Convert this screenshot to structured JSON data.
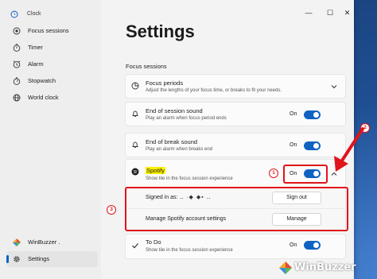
{
  "window": {
    "app_title": "Clock",
    "controls": [
      "—",
      "☐",
      "✕"
    ]
  },
  "sidebar": {
    "items": [
      {
        "label": "Focus sessions",
        "icon": "focus-icon"
      },
      {
        "label": "Timer",
        "icon": "timer-icon"
      },
      {
        "label": "Alarm",
        "icon": "alarm-icon"
      },
      {
        "label": "Stopwatch",
        "icon": "stopwatch-icon"
      },
      {
        "label": "World clock",
        "icon": "globe-icon"
      }
    ],
    "account_label": "WinBuzzer .",
    "settings_label": "Settings"
  },
  "main": {
    "title": "Settings",
    "section": "Focus sessions",
    "focus_periods": {
      "title": "Focus periods",
      "desc": "Adjust the lengths of your focus time, or breaks to fit your needs."
    },
    "end_session_sound": {
      "title": "End of session sound",
      "desc": "Play an alarm when focus period ends",
      "toggle": "On"
    },
    "end_break_sound": {
      "title": "End of break sound",
      "desc": "Play an alarm when breaks end",
      "toggle": "On"
    },
    "spotify": {
      "title": "Spotify",
      "desc": "Show tile in the focus session experience",
      "toggle": "On",
      "signed_in_label": "Signed in as:",
      "signed_in_value": "‥ ∙◆ ◆▪ ‥",
      "sign_out": "Sign out",
      "manage_label": "Manage Spotify account settings",
      "manage": "Manage"
    },
    "todo": {
      "title": "To Do",
      "desc": "Show tile in the focus session experience",
      "toggle": "On"
    }
  },
  "annotations": [
    "1",
    "2",
    "3"
  ],
  "watermark": "WinBuzzer",
  "colors": {
    "accent": "#0f62c1",
    "annotation": "#e0141b",
    "highlight": "#fff200"
  }
}
